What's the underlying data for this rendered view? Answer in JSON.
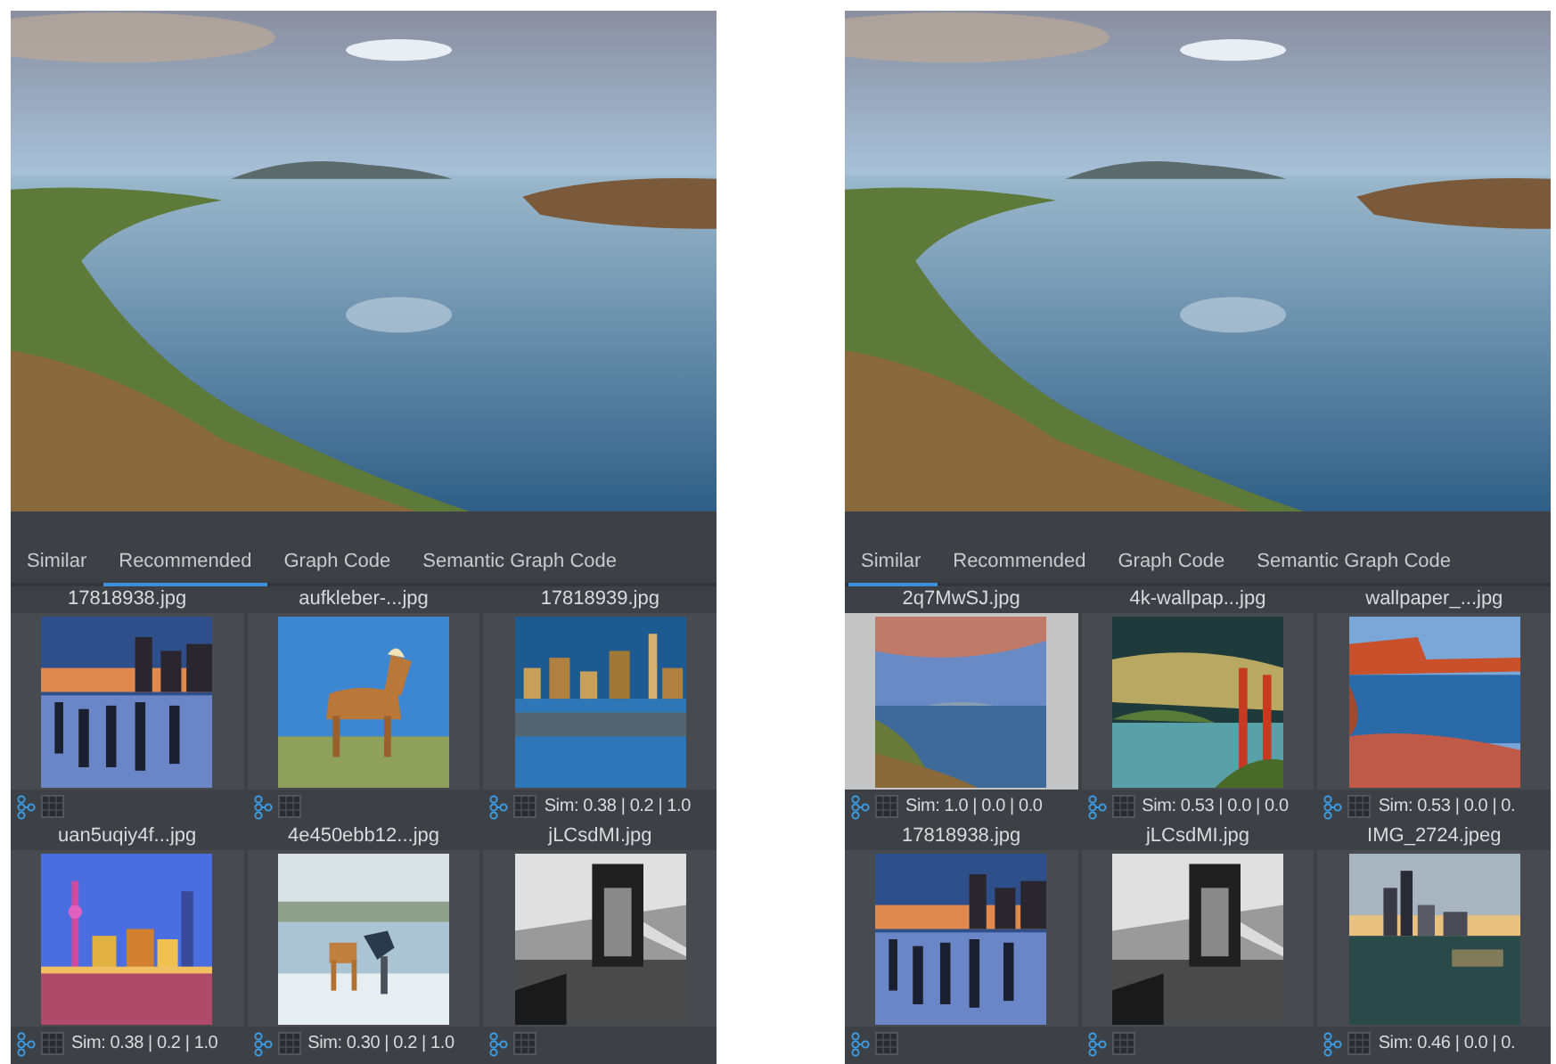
{
  "panels": [
    {
      "tabs": [
        {
          "label": "Similar",
          "selected": false
        },
        {
          "label": "Recommended",
          "selected": true
        },
        {
          "label": "Graph Code",
          "selected": false
        },
        {
          "label": "Semantic Graph Code",
          "selected": false
        }
      ],
      "results": [
        {
          "filename": "17818938.jpg",
          "selected": false
        },
        {
          "filename": "aufkleber-...jpg",
          "selected": false
        },
        {
          "filename": "17818939.jpg",
          "selected": false,
          "sim": "Sim: 0.38 | 0.2 | 1.0"
        },
        {
          "filename": "uan5uqiy4f...jpg",
          "selected": false,
          "sim": "Sim: 0.38 | 0.2 | 1.0"
        },
        {
          "filename": "4e450ebb12...jpg",
          "selected": false,
          "sim": "Sim: 0.30 | 0.2 | 1.0"
        },
        {
          "filename": "jLCsdMI.jpg",
          "selected": false
        }
      ]
    },
    {
      "tabs": [
        {
          "label": "Similar",
          "selected": true
        },
        {
          "label": "Recommended",
          "selected": false
        },
        {
          "label": "Graph Code",
          "selected": false
        },
        {
          "label": "Semantic Graph Code",
          "selected": false
        }
      ],
      "results": [
        {
          "filename": "2q7MwSJ.jpg",
          "selected": true,
          "sim": "Sim: 1.0 | 0.0 | 0.0"
        },
        {
          "filename": "4k-wallpap...jpg",
          "selected": false,
          "sim": "Sim: 0.53 | 0.0 | 0.0"
        },
        {
          "filename": "wallpaper_...jpg",
          "selected": false,
          "sim": "Sim: 0.53 | 0.0 | 0."
        },
        {
          "filename": "17818938.jpg",
          "selected": false
        },
        {
          "filename": "jLCsdMI.jpg",
          "selected": false
        },
        {
          "filename": "IMG_2724.jpeg",
          "selected": false,
          "sim": "Sim: 0.46 | 0.0 | 0."
        }
      ]
    }
  ]
}
